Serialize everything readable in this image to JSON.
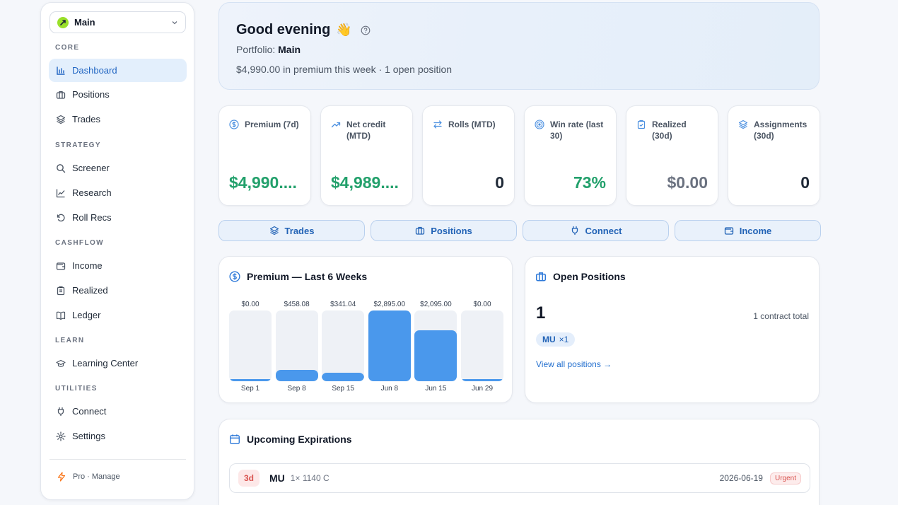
{
  "sidebar": {
    "portfolio": "Main",
    "sections": {
      "core": "CORE",
      "strategy": "STRATEGY",
      "cashflow": "CASHFLOW",
      "learn": "LEARN",
      "utilities": "UTILITIES"
    },
    "items": {
      "dashboard": "Dashboard",
      "positions": "Positions",
      "trades": "Trades",
      "screener": "Screener",
      "research": "Research",
      "roll_recs": "Roll Recs",
      "income": "Income",
      "realized": "Realized",
      "ledger": "Ledger",
      "learning_center": "Learning Center",
      "connect": "Connect",
      "settings": "Settings"
    },
    "pro": "Pro · Manage",
    "active": "Dashboard"
  },
  "hero": {
    "greeting": "Good evening",
    "wave": "👋",
    "portfolio_label": "Portfolio:",
    "portfolio_name": "Main",
    "summary": "$4,990.00 in premium this week · 1 open position"
  },
  "stats": [
    {
      "label": "Premium (7d)",
      "value": "$4,990....",
      "icon": "dollar-circle-icon"
    },
    {
      "label": "Net credit (MTD)",
      "value": "$4,989....",
      "icon": "trend-up-icon"
    },
    {
      "label": "Rolls (MTD)",
      "value": "0",
      "icon": "arrows-swap-icon"
    },
    {
      "label": "Win rate (last 30)",
      "value": "73%",
      "icon": "target-icon"
    },
    {
      "label": "Realized (30d)",
      "value": "$0.00",
      "icon": "clipboard-check-icon"
    },
    {
      "label": "Assignments (30d)",
      "value": "0",
      "icon": "layers-icon"
    }
  ],
  "quick_actions": {
    "trades": "Trades",
    "positions": "Positions",
    "connect": "Connect",
    "income": "Income"
  },
  "premium_panel": {
    "title": "Premium — Last 6 Weeks"
  },
  "chart_data": {
    "type": "bar",
    "title": "Premium — Last 6 Weeks",
    "categories": [
      "Sep 1",
      "Sep 8",
      "Sep 15",
      "Jun 8",
      "Jun 15",
      "Jun 29"
    ],
    "values": [
      0.0,
      458.08,
      341.04,
      2895.0,
      2095.0,
      0.0
    ],
    "value_labels": [
      "$0.00",
      "$458.08",
      "$341.04",
      "$2,895.00",
      "$2,095.00",
      "$0.00"
    ],
    "ylim": [
      0,
      2895
    ],
    "grid": false,
    "color": "#4a98ec"
  },
  "open_positions": {
    "title": "Open Positions",
    "count": "1",
    "total": "1 contract total",
    "chip_symbol": "MU",
    "chip_qty": "×1",
    "link": "View all positions →"
  },
  "expirations": {
    "title": "Upcoming Expirations",
    "rows": [
      {
        "days": "3d",
        "symbol": "MU",
        "detail": "1× 1140 C",
        "date": "2026-06-19",
        "status": "Urgent"
      }
    ]
  }
}
